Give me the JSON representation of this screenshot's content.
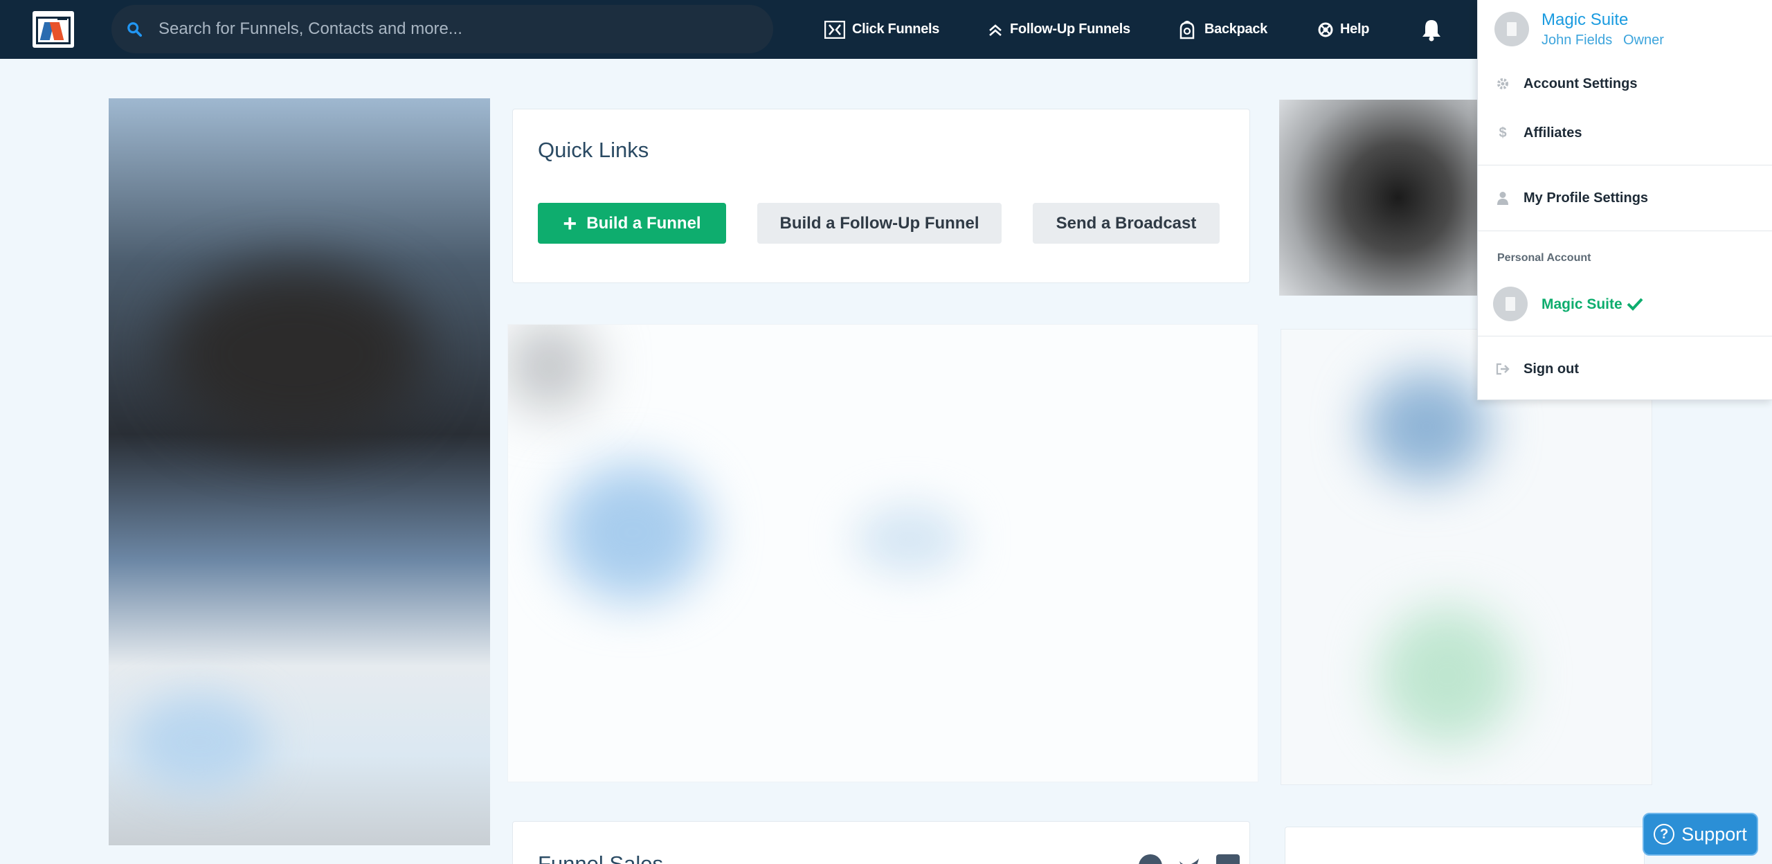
{
  "header": {
    "search_placeholder": "Search for Funnels, Contacts and more...",
    "nav": [
      {
        "label": "Click Funnels",
        "icon": "funnel-icon"
      },
      {
        "label": "Follow-Up Funnels",
        "icon": "chevron-up-icon"
      },
      {
        "label": "Backpack",
        "icon": "backpack-icon"
      },
      {
        "label": "Help",
        "icon": "help-icon"
      }
    ]
  },
  "quick_links": {
    "title": "Quick Links",
    "build_funnel": "Build a Funnel",
    "build_followup": "Build a Follow-Up Funnel",
    "send_broadcast": "Send a Broadcast"
  },
  "funnel_sales": {
    "title": "Funnel Sales"
  },
  "dropdown": {
    "account_name": "Magic Suite",
    "user_name": "John Fields",
    "role": "Owner",
    "account_settings": "Account Settings",
    "affiliates": "Affiliates",
    "profile_settings": "My Profile Settings",
    "section_label": "Personal Account",
    "personal_account": "Magic Suite",
    "sign_out": "Sign out"
  },
  "support": {
    "label": "Support"
  },
  "colors": {
    "nav_bg": "#10283d",
    "accent_green": "#0ead6e",
    "link_blue": "#1a9be0",
    "page_bg": "#f0f7fc"
  }
}
